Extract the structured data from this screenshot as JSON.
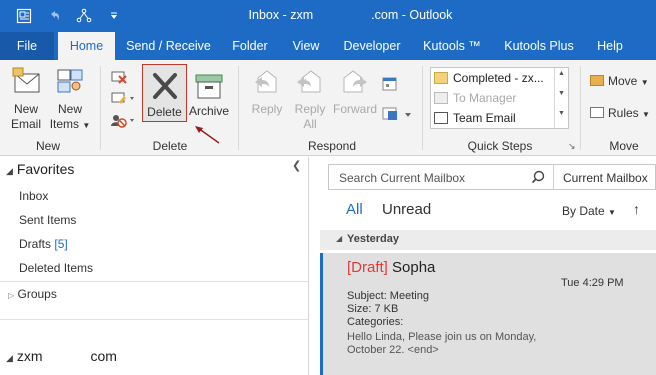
{
  "window": {
    "title_left": "Inbox - zxm",
    "title_right": ".com  -  Outlook"
  },
  "tabs": [
    "File",
    "Home",
    "Send / Receive",
    "Folder",
    "View",
    "Developer",
    "Kutools ™",
    "Kutools Plus",
    "Help"
  ],
  "ribbon": {
    "new_email_l1": "New",
    "new_email_l2": "Email",
    "new_items_l1": "New",
    "new_items_l2": "Items",
    "group_new": "New",
    "delete": "Delete",
    "archive": "Archive",
    "group_delete": "Delete",
    "reply": "Reply",
    "reply_all_l1": "Reply",
    "reply_all_l2": "All",
    "forward": "Forward",
    "group_respond": "Respond",
    "quick_steps": [
      "Completed - zx...",
      "To Manager",
      "Team Email"
    ],
    "group_quick_steps": "Quick Steps",
    "move": "Move",
    "rules": "Rules",
    "group_move": "Move"
  },
  "nav": {
    "favorites": "Favorites",
    "items": [
      "Inbox",
      "Sent Items"
    ],
    "drafts": "Drafts",
    "drafts_count": "[5]",
    "deleted": "Deleted Items",
    "groups": "Groups",
    "account": "zxm",
    "account_suffix": "com"
  },
  "search": {
    "placeholder": "Search Current Mailbox",
    "scope": "Current Mailbox"
  },
  "filter": {
    "all": "All",
    "unread": "Unread",
    "sort": "By Date"
  },
  "group_header": "Yesterday",
  "message": {
    "tag": "[Draft]",
    "sender": "Sopha",
    "time": "Tue 4:29 PM",
    "subject": "Subject: Meeting",
    "size": "Size: 7 KB",
    "categories": "Categories:",
    "preview_l1": "Hello Linda,  Please join us on Monday,",
    "preview_l2": "October 22.  <end>"
  },
  "colors": {
    "accent": "#1e6bc6",
    "draft": "#e33a3a",
    "delete_outline": "#c0392b"
  }
}
